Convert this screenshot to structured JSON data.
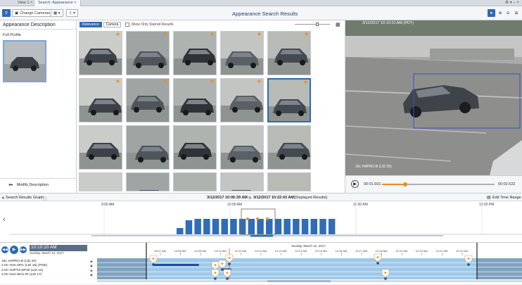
{
  "tabs": [
    {
      "label": "View 1 ×"
    },
    {
      "label": "Search: Appearance ×"
    }
  ],
  "toolbar": {
    "change_cameras_label": "Change Cameras",
    "title": "Appearance Search Results"
  },
  "left_panel": {
    "title": "Appearance Description",
    "full_profile_label": "Full Profile",
    "modify_label": "Modify Description"
  },
  "grid": {
    "sort_relevance": "Relevance",
    "sort_camera": "Camera",
    "starred_only_label": "Show Only Starred Results"
  },
  "video": {
    "timestamp": "3/12/2017 10:10:10 AM (PDT)",
    "camera_label": "16L-H4PRO-B (LID 20)",
    "elapsed": "00:01.601",
    "total": "00:02.622"
  },
  "graph": {
    "header_label": "Search Results Graph",
    "range_start": "3/12/2017 10:06:39 AM",
    "range_end": "3/12/2017 10:22:43 AM",
    "displayed_label": "[Displayed Results]",
    "edit_range_label": "Edit Time Range",
    "hour_labels": [
      "9:00 AM",
      "10:00 AM",
      "11:00 AM",
      "12:00 PM"
    ]
  },
  "timeline": {
    "clock": "10:10:10 AM",
    "date": "Sunday, March 12, 2017",
    "date_center": "Sunday, March 12, 2017",
    "ticks": [
      "10:07 AM",
      "10:08 AM",
      "10:09 AM",
      "10:10 AM",
      "10:11 AM",
      "10:12 AM",
      "10:13 AM",
      "10:14 AM",
      "10:15 AM",
      "10:16 AM",
      "10:17 AM",
      "10:18 AM",
      "10:19 AM",
      "10:20 AM",
      "10:21 AM",
      "10:22 AM"
    ],
    "lanes": [
      {
        "label": "16L-H4PRO-B (LID 20)"
      },
      {
        "label": "2.0C-H4A-DP1 (LID 15) (POE)"
      },
      {
        "label": "2.0C-H4PTZ-DP30 (LID 12)"
      },
      {
        "label": "2.0C-H4A-BO1-IR (LID 17)"
      }
    ]
  },
  "colors": {
    "accent": "#2e6ab3",
    "star": "#f08a1c",
    "bar": "#2f6db8"
  }
}
